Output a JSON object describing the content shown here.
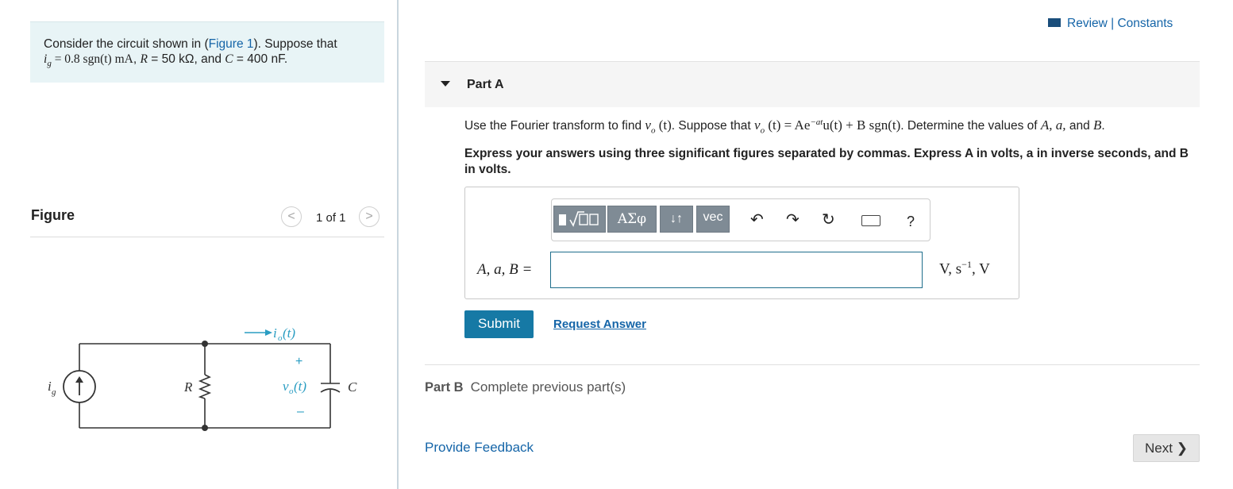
{
  "problem": {
    "line1_prefix": "Consider the circuit shown in (",
    "figure_link": "Figure 1",
    "line1_suffix": "). Suppose that",
    "ig": "i",
    "ig_sub": "g",
    "eq_expr": " = 0.8 sgn(t) mA",
    "r_prefix": ", ",
    "r_sym": "R",
    "r_val": " = 50 kΩ",
    "c_prefix": ", and ",
    "c_sym": "C",
    "c_val": " = 400 nF."
  },
  "figure": {
    "title": "Figure",
    "count": "1 of 1",
    "prev_glyph": "<",
    "next_glyph": ">",
    "labels": {
      "io": "i",
      "io_sub": "o",
      "io_arg": "(t)",
      "ig": "i",
      "ig_sub": "g",
      "r": "R",
      "c": "C",
      "vo": "v",
      "vo_sub": "o",
      "vo_arg": "(t)",
      "plus": "+",
      "minus": "–"
    }
  },
  "header": {
    "review": "Review",
    "sep": " | ",
    "constants": "Constants"
  },
  "part_a": {
    "title": "Part A",
    "question_prefix": "Use the Fourier transform to find ",
    "vo": "v",
    "vo_sub": "o",
    "vo_arg": " (t)",
    "question_mid": ". Suppose that ",
    "expr": "v",
    "expr_sub": "o",
    "expr_rest": " (t) = Ae",
    "expr_exp": "−at",
    "expr_tail": "u(t) + B sgn(t)",
    "question_end": ". Determine the values of ",
    "vars": "A, a,",
    "and": " and ",
    "var_b": "B",
    "period": ".",
    "instructions": "Express your answers using three significant figures separated by commas. Express A in volts, a in inverse seconds, and B in volts.",
    "answer_label": "A, a, B =",
    "answer_value": "",
    "units": "V, s",
    "units_exp": "−1",
    "units_tail": ", V",
    "toolbar": {
      "greek": "ΑΣφ",
      "arrows": "↓↑",
      "vec": "vec",
      "undo": "↶",
      "redo": "↷",
      "reset": "↻",
      "help": "?"
    },
    "submit": "Submit",
    "request": "Request Answer"
  },
  "part_b": {
    "label": "Part B",
    "text": "Complete previous part(s)"
  },
  "footer": {
    "feedback": "Provide Feedback",
    "next": "Next ❯"
  },
  "colors": {
    "accent": "#1565a8",
    "submit_bg": "#1679a5",
    "problem_bg": "#e8f4f6",
    "toolbar_btn": "#7f8b95"
  }
}
